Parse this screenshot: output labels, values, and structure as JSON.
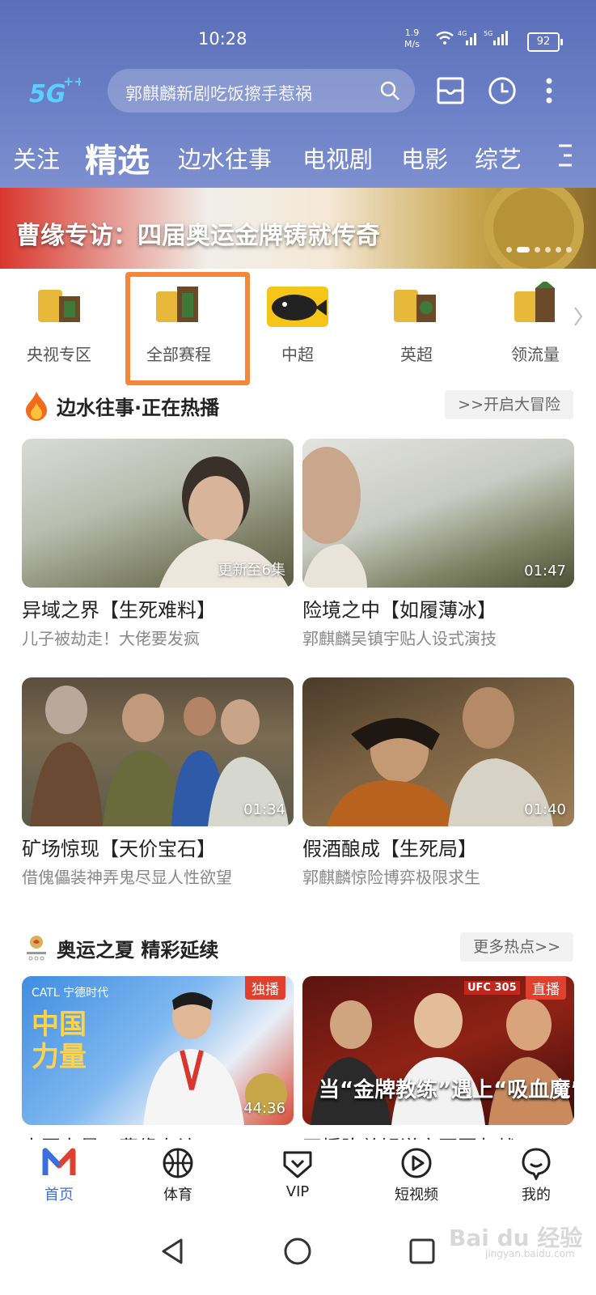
{
  "status": {
    "time": "10:28",
    "speed_value": "1.9",
    "speed_unit": "M/s",
    "net1": "4G",
    "net2": "5G",
    "battery": "92"
  },
  "header": {
    "logo": "5G++",
    "search_placeholder": "郭麒麟新剧吃饭擦手惹祸"
  },
  "tabs": [
    {
      "label": "关注"
    },
    {
      "label": "精选",
      "active": true
    },
    {
      "label": "边水往事"
    },
    {
      "label": "电视剧"
    },
    {
      "label": "电影"
    },
    {
      "label": "综艺"
    }
  ],
  "banner": {
    "title": "曹缘专访：四届奥运金牌铸就传奇"
  },
  "categories": [
    {
      "label": "央视专区"
    },
    {
      "label": "全部赛程"
    },
    {
      "label": "中超"
    },
    {
      "label": "英超"
    },
    {
      "label": "领流量"
    }
  ],
  "section1": {
    "title": "边水往事·正在热播",
    "action": ">>开启大冒险",
    "cards": [
      {
        "tag": "更新至6集",
        "title": "异域之界【生死难料】",
        "subtitle": "儿子被劫走！大佬要发疯"
      },
      {
        "tag": "01:47",
        "title": "险境之中【如履薄冰】",
        "subtitle": "郭麒麟吴镇宇贴人设式演技"
      },
      {
        "tag": "01:34",
        "title": "矿场惊现【天价宝石】",
        "subtitle": "借傀儡装神弄鬼尽显人性欲望"
      },
      {
        "tag": "01:40",
        "title": "假酒酿成【生死局】",
        "subtitle": "郭麒麟惊险博弈极限求生"
      }
    ]
  },
  "section2": {
    "title": "奥运之夏 精彩延续",
    "action": "更多热点>>",
    "cards": [
      {
        "badge": "独播",
        "tag": "44:36",
        "title": "中国力量：曹缘专访",
        "thumb_text": "中国力量",
        "brand": "CATL 宁德时代"
      },
      {
        "badge": "直播",
        "tag": "",
        "title": "正播陈总解说亮哥回归战",
        "thumb_text": "当“金牌教练”遇上“吸血魔”",
        "brand": "UFC 305"
      }
    ]
  },
  "bottom_nav": [
    {
      "label": "首页",
      "active": true
    },
    {
      "label": "体育"
    },
    {
      "label": "VIP"
    },
    {
      "label": "短视频"
    },
    {
      "label": "我的"
    }
  ],
  "watermark": {
    "text": "Bai du 经验",
    "sub": "jingyan.baidu.com"
  },
  "colors": {
    "accent": "#3b6fe0",
    "highlight": "#f5873b",
    "badge": "#e0412f",
    "header": "#6b7fc6"
  }
}
